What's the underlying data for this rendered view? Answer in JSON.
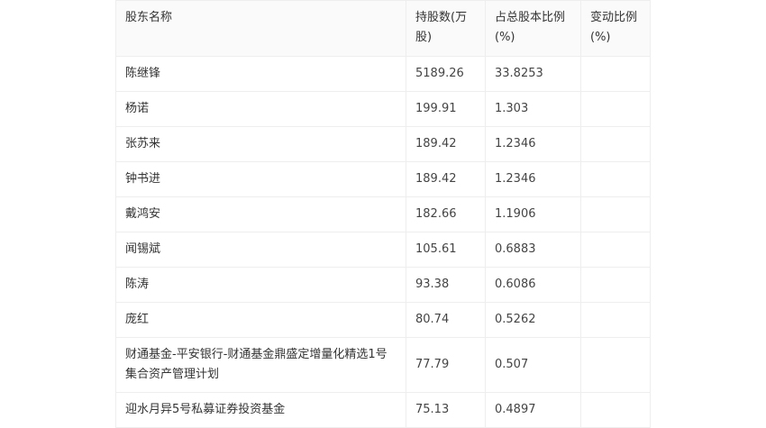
{
  "headers": [
    "股东名称",
    "持股数(万股)",
    "占总股本比例(%)",
    "变动比例(%)"
  ],
  "rows": [
    {
      "name": "陈继锋",
      "shares": "5189.26",
      "ratio": "33.8253",
      "change": ""
    },
    {
      "name": "杨诺",
      "shares": "199.91",
      "ratio": "1.303",
      "change": ""
    },
    {
      "name": "张苏来",
      "shares": "189.42",
      "ratio": "1.2346",
      "change": ""
    },
    {
      "name": "钟书进",
      "shares": "189.42",
      "ratio": "1.2346",
      "change": ""
    },
    {
      "name": "戴鸿安",
      "shares": "182.66",
      "ratio": "1.1906",
      "change": ""
    },
    {
      "name": "闻锡斌",
      "shares": "105.61",
      "ratio": "0.6883",
      "change": ""
    },
    {
      "name": "陈涛",
      "shares": "93.38",
      "ratio": "0.6086",
      "change": ""
    },
    {
      "name": "庞红",
      "shares": "80.74",
      "ratio": "0.5262",
      "change": ""
    },
    {
      "name": "财通基金-平安银行-财通基金鼎盛定增量化精选1号集合资产管理计划",
      "shares": "77.79",
      "ratio": "0.507",
      "change": ""
    },
    {
      "name": "迎水月异5号私募证券投资基金",
      "shares": "75.13",
      "ratio": "0.4897",
      "change": ""
    }
  ]
}
